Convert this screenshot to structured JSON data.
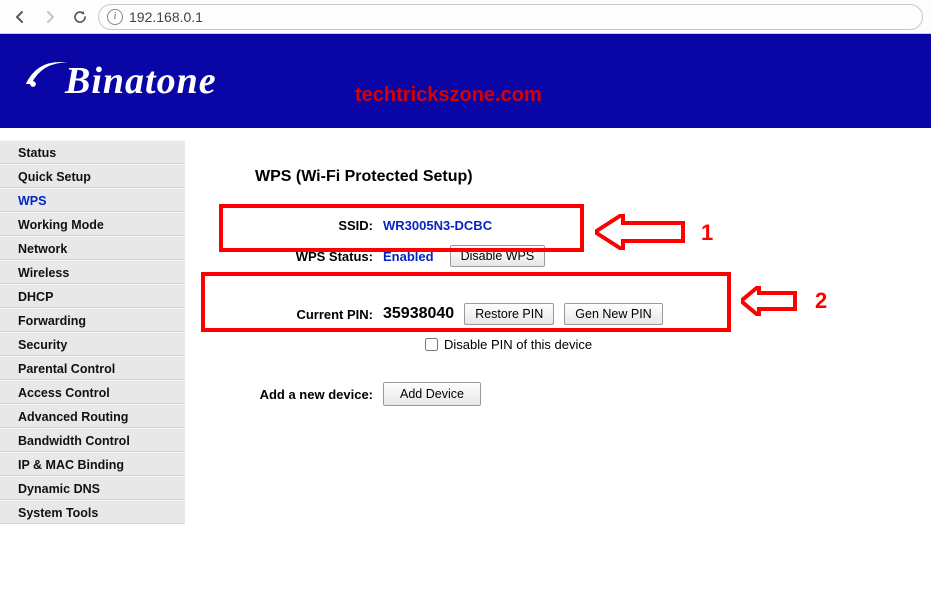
{
  "browser": {
    "url": "192.168.0.1"
  },
  "brand": "Binatone",
  "watermark": "techtrickszone.com",
  "sidebar": {
    "items": [
      {
        "label": "Status"
      },
      {
        "label": "Quick Setup"
      },
      {
        "label": "WPS",
        "active": true
      },
      {
        "label": "Working Mode"
      },
      {
        "label": "Network"
      },
      {
        "label": "Wireless"
      },
      {
        "label": "DHCP"
      },
      {
        "label": "Forwarding"
      },
      {
        "label": "Security"
      },
      {
        "label": "Parental Control"
      },
      {
        "label": "Access Control"
      },
      {
        "label": "Advanced Routing"
      },
      {
        "label": "Bandwidth Control"
      },
      {
        "label": "IP & MAC Binding"
      },
      {
        "label": "Dynamic DNS"
      },
      {
        "label": "System Tools"
      }
    ]
  },
  "page": {
    "title": "WPS (Wi-Fi Protected Setup)",
    "ssid_label": "SSID:",
    "ssid_value": "WR3005N3-DCBC",
    "wps_status_label": "WPS Status:",
    "wps_status_value": "Enabled",
    "disable_wps_btn": "Disable WPS",
    "current_pin_label": "Current PIN:",
    "current_pin_value": "35938040",
    "restore_pin_btn": "Restore PIN",
    "gen_new_pin_btn": "Gen New PIN",
    "disable_pin_label": "Disable PIN of this device",
    "add_device_label": "Add a new device:",
    "add_device_btn": "Add Device"
  },
  "annotations": {
    "one": "1",
    "two": "2"
  }
}
